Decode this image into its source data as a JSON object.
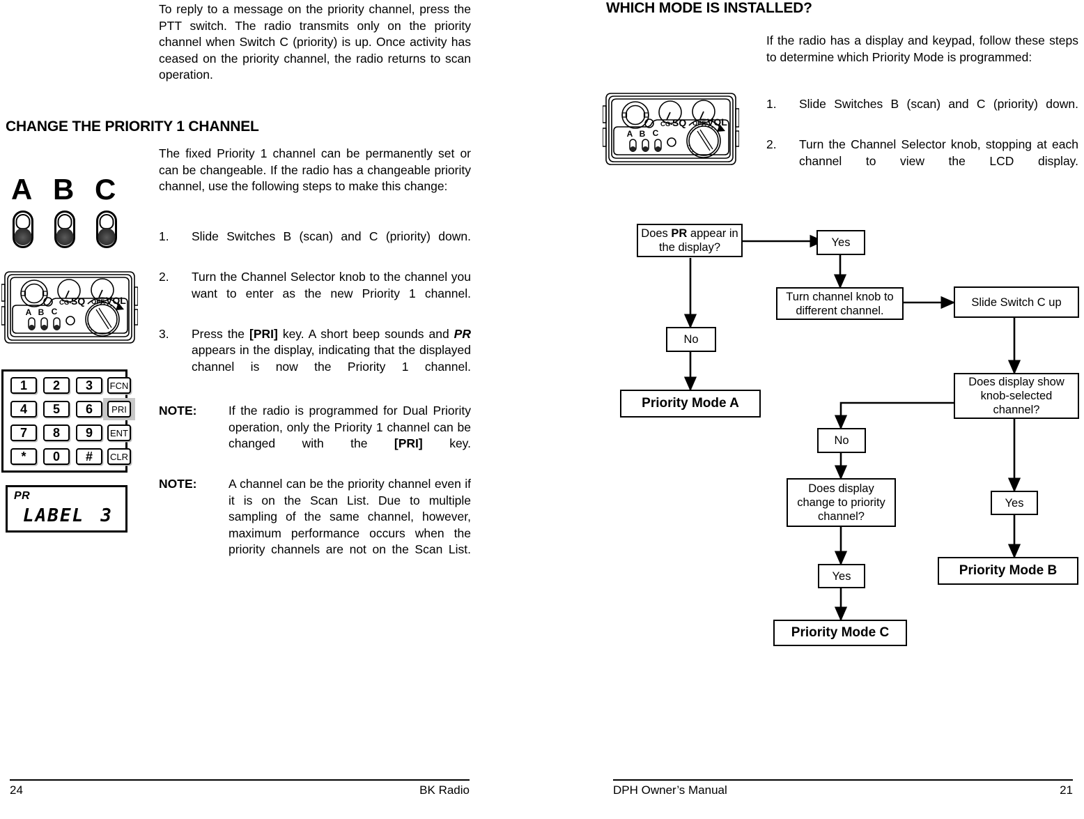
{
  "left_column": {
    "intro_paragraph": "To reply to a message on the priority channel, press the PTT switch. The radio transmits only on the priority channel when Switch C (priority) is up. Once activity has ceased on the priority channel, the radio returns to scan operation.",
    "section_heading": "CHANGE THE PRIORITY 1 CHANNEL",
    "lead_paragraph": "The fixed Priority 1 channel can be permanently set or can be changeable. If the radio has a changeable priority channel, use the following steps to make this change:",
    "steps": [
      {
        "num": "1.",
        "text_parts": [
          "Slide Switches B (scan) and C (priority) down."
        ]
      },
      {
        "num": "2.",
        "text_parts": [
          "Turn the Channel Selector knob to the channel you want to enter as the new Priority 1 channel."
        ]
      },
      {
        "num": "3.",
        "pre": "Press the ",
        "bold1": "[PRI]",
        "mid1": " key. A short beep sounds and ",
        "bolditalic1": "PR",
        "post": " appears in the display, indicating that the displayed channel is now the Priority 1 channel."
      }
    ],
    "notes": [
      {
        "label": "NOTE:",
        "pre": "If the radio is programmed for Dual Priority operation, only the Priority 1 channel can be changed with the ",
        "bold": "[PRI]",
        "post": " key."
      },
      {
        "label": "NOTE:",
        "pre": "A channel can be the priority channel even if it is on the Scan List.  Due to multiple sampling of the same channel, however, maximum performance occurs when the priority channels are not on the Scan List.",
        "bold": "",
        "post": ""
      }
    ],
    "switch_figure": {
      "labels": [
        "A",
        "B",
        "C"
      ]
    },
    "radio_figure": {
      "knob_labels": [
        "CG-",
        "SQ",
        "OFF-",
        "VOL"
      ],
      "switch_labels": [
        "A",
        "B",
        "C"
      ]
    },
    "keypad": {
      "rows": [
        [
          "1",
          "2",
          "3",
          "FCN"
        ],
        [
          "4",
          "5",
          "6",
          "PRI"
        ],
        [
          "7",
          "8",
          "9",
          "ENT"
        ],
        [
          "*",
          "0",
          "#",
          "CLR"
        ]
      ],
      "highlighted_key": "PRI"
    },
    "lcd": {
      "indicator": "PR",
      "label_text": "LABEL",
      "channel": "3"
    },
    "footer": {
      "page_number": "24",
      "title": "BK Radio"
    }
  },
  "right_column": {
    "section_heading": "WHICH MODE IS INSTALLED?",
    "lead_paragraph": "If the radio has a display and keypad, follow these steps to determine which Priority Mode is programmed:",
    "steps": [
      {
        "num": "1.",
        "text": "Slide Switches B (scan) and C (priority) down."
      },
      {
        "num": "2.",
        "text": "Turn the Channel Selector knob, stopping at each channel to view the LCD display."
      }
    ],
    "radio_figure": {
      "knob_labels": [
        "CG-",
        "SQ",
        "OFF-",
        "VOL"
      ],
      "switch_labels": [
        "A",
        "B",
        "C"
      ]
    },
    "flowchart": {
      "nodes": {
        "q_pr": {
          "pre": "Does ",
          "bold": "PR",
          "post": " appear in the display?"
        },
        "yes_1": "Yes",
        "no_1": "No",
        "mode_a": "Priority Mode A",
        "turn_knob": "Turn channel knob to different channel.",
        "slide_c": "Slide Switch C up",
        "q_knob_channel": "Does display show knob-selected channel?",
        "yes_2": "Yes",
        "mode_b": "Priority Mode B",
        "no_2": "No",
        "q_change_priority": "Does display change to priority channel?",
        "yes_3": "Yes",
        "mode_c": "Priority Mode C"
      }
    },
    "footer": {
      "title": "DPH Owner’s Manual",
      "page_number": "21"
    }
  }
}
